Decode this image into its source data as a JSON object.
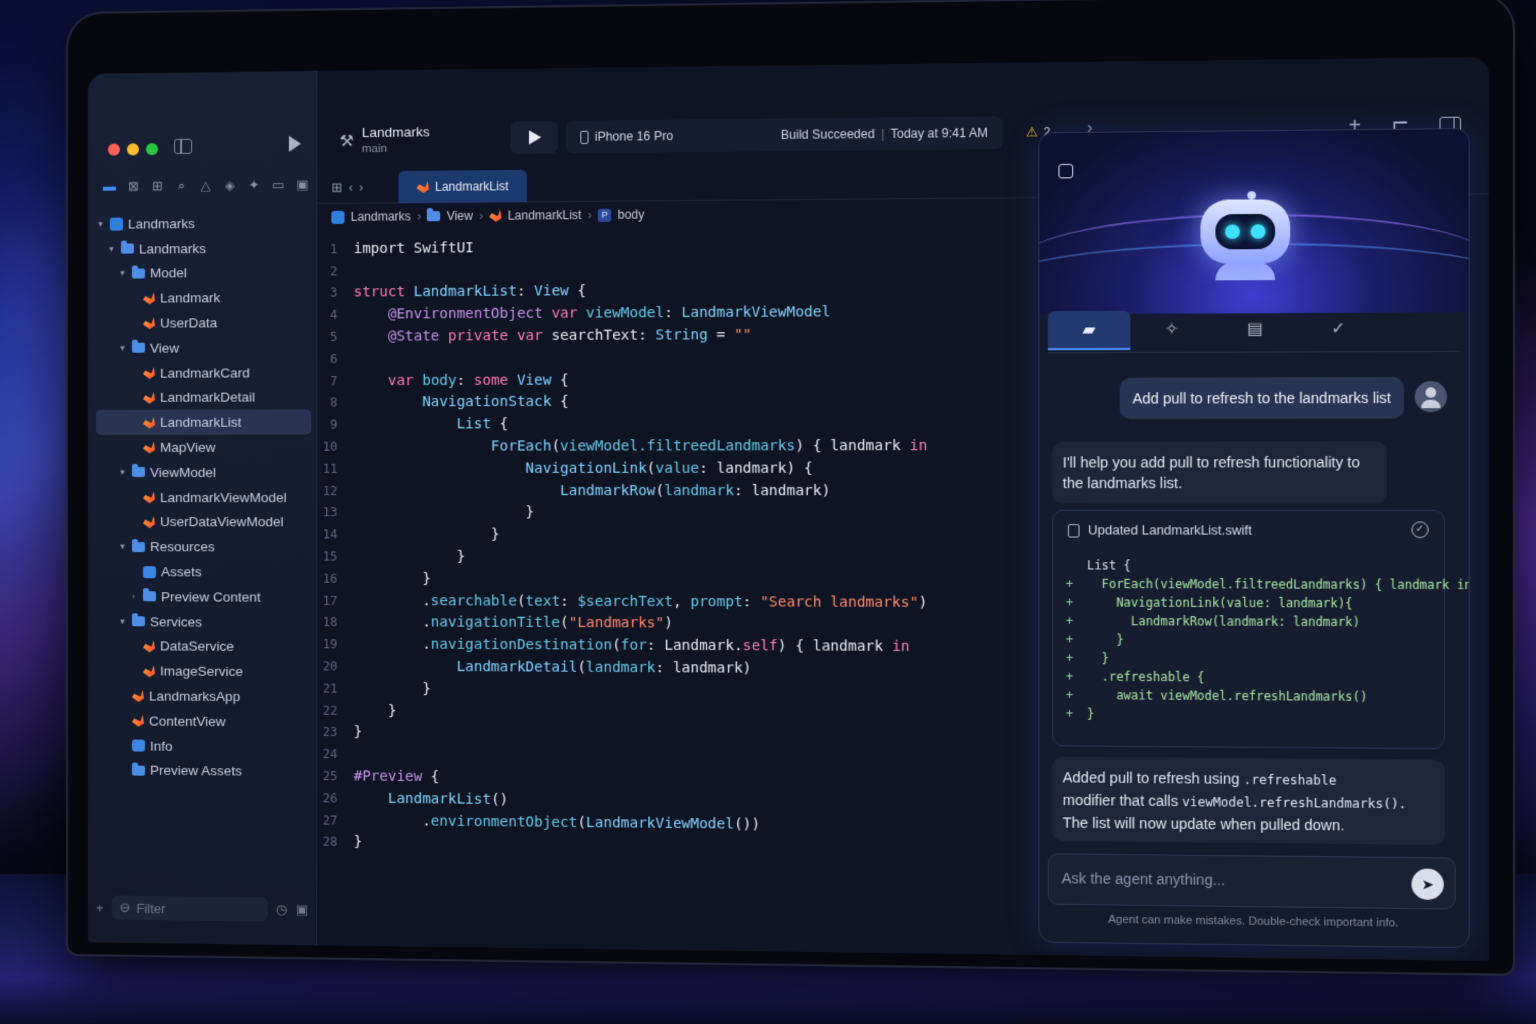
{
  "colors": {
    "accent": "#3a8cff",
    "keyword": "#ff7ab6",
    "type": "#7fd4ff",
    "string": "#ff8a6b",
    "diff_add": "#7fe28f",
    "warning": "#f5b82e"
  },
  "window": {
    "traffic": [
      "close",
      "minimize",
      "zoom"
    ]
  },
  "toolbar": {
    "project": "Landmarks",
    "branch": "main",
    "device": "iPhone 16 Pro",
    "build_status": "Build Succeeded",
    "separator": "|",
    "build_time": "Today at 9:41 AM",
    "warnings": "2"
  },
  "tab": {
    "label": "LandmarkList"
  },
  "breadcrumb": [
    "Landmarks",
    "View",
    "LandmarkList",
    "body"
  ],
  "navigator": {
    "items": [
      {
        "label": "Landmarks",
        "icon": "project",
        "depth": 0,
        "open": true
      },
      {
        "label": "Landmarks",
        "icon": "folder",
        "depth": 1,
        "open": true
      },
      {
        "label": "Model",
        "icon": "folder",
        "depth": 2,
        "open": true
      },
      {
        "label": "Landmark",
        "icon": "swift",
        "depth": 3
      },
      {
        "label": "UserData",
        "icon": "swift",
        "depth": 3
      },
      {
        "label": "View",
        "icon": "folder",
        "depth": 2,
        "open": true
      },
      {
        "label": "LandmarkCard",
        "icon": "swift",
        "depth": 3
      },
      {
        "label": "LandmarkDetail",
        "icon": "swift",
        "depth": 3
      },
      {
        "label": "LandmarkList",
        "icon": "swift",
        "depth": 3,
        "selected": true
      },
      {
        "label": "MapView",
        "icon": "swift",
        "depth": 3
      },
      {
        "label": "ViewModel",
        "icon": "folder",
        "depth": 2,
        "open": true
      },
      {
        "label": "LandmarkViewModel",
        "icon": "swift",
        "depth": 3
      },
      {
        "label": "UserDataViewModel",
        "icon": "swift",
        "depth": 3
      },
      {
        "label": "Resources",
        "icon": "folder",
        "depth": 2,
        "open": true
      },
      {
        "label": "Assets",
        "icon": "asset",
        "depth": 3
      },
      {
        "label": "Preview Content",
        "icon": "folder",
        "depth": 3,
        "open": false
      },
      {
        "label": "Services",
        "icon": "folder",
        "depth": 2,
        "open": true
      },
      {
        "label": "DataService",
        "icon": "swift",
        "depth": 3
      },
      {
        "label": "ImageService",
        "icon": "swift",
        "depth": 3
      },
      {
        "label": "LandmarksApp",
        "icon": "swift",
        "depth": 2
      },
      {
        "label": "ContentView",
        "icon": "swift",
        "depth": 2
      },
      {
        "label": "Info",
        "icon": "asset",
        "depth": 2
      },
      {
        "label": "Preview Assets",
        "icon": "folder",
        "depth": 2
      }
    ],
    "filter_placeholder": "Filter"
  },
  "code": [
    [
      [
        "pl",
        "import SwiftUI"
      ]
    ],
    [],
    [
      [
        "kw",
        "struct"
      ],
      [
        "pl",
        " "
      ],
      [
        "ty",
        "LandmarkList"
      ],
      [
        "pl",
        ": "
      ],
      [
        "ty",
        "View"
      ],
      [
        "pl",
        " {"
      ]
    ],
    [
      [
        "pl",
        "    "
      ],
      [
        "attr",
        "@EnvironmentObject"
      ],
      [
        "pl",
        " "
      ],
      [
        "kw",
        "var"
      ],
      [
        "pl",
        " "
      ],
      [
        "fn",
        "viewModel"
      ],
      [
        "pl",
        ": "
      ],
      [
        "ty",
        "LandmarkViewModel"
      ]
    ],
    [
      [
        "pl",
        "    "
      ],
      [
        "attr",
        "@State"
      ],
      [
        "pl",
        " "
      ],
      [
        "kw",
        "private"
      ],
      [
        "pl",
        " "
      ],
      [
        "kw",
        "var"
      ],
      [
        "pl",
        " searchText: "
      ],
      [
        "ty",
        "String"
      ],
      [
        "pl",
        " = "
      ],
      [
        "str",
        "\"\""
      ]
    ],
    [],
    [
      [
        "pl",
        "    "
      ],
      [
        "kw",
        "var"
      ],
      [
        "pl",
        " "
      ],
      [
        "fn",
        "body"
      ],
      [
        "pl",
        ": "
      ],
      [
        "kw",
        "some"
      ],
      [
        "pl",
        " "
      ],
      [
        "ty",
        "View"
      ],
      [
        "pl",
        " {"
      ]
    ],
    [
      [
        "pl",
        "        "
      ],
      [
        "ty",
        "NavigationStack"
      ],
      [
        "pl",
        " {"
      ]
    ],
    [
      [
        "pl",
        "            "
      ],
      [
        "ty",
        "List"
      ],
      [
        "pl",
        " {"
      ]
    ],
    [
      [
        "pl",
        "                "
      ],
      [
        "ty",
        "ForEach"
      ],
      [
        "pl",
        "("
      ],
      [
        "fn",
        "viewModel.filtreedLandmarks"
      ],
      [
        "pl",
        ") { landmark "
      ],
      [
        "kw",
        "in"
      ]
    ],
    [
      [
        "pl",
        "                    "
      ],
      [
        "ty",
        "NavigationLink"
      ],
      [
        "pl",
        "("
      ],
      [
        "fn",
        "value"
      ],
      [
        "pl",
        ": landmark) {"
      ]
    ],
    [
      [
        "pl",
        "                        "
      ],
      [
        "ty",
        "LandmarkRow"
      ],
      [
        "pl",
        "("
      ],
      [
        "fn",
        "landmark"
      ],
      [
        "pl",
        ": landmark)"
      ]
    ],
    [
      [
        "pl",
        "                    }"
      ]
    ],
    [
      [
        "pl",
        "                }"
      ]
    ],
    [
      [
        "pl",
        "            }"
      ]
    ],
    [
      [
        "pl",
        "        }"
      ]
    ],
    [
      [
        "pl",
        "        ."
      ],
      [
        "fn",
        "searchable"
      ],
      [
        "pl",
        "("
      ],
      [
        "fn",
        "text"
      ],
      [
        "pl",
        ": "
      ],
      [
        "fn",
        "$searchText"
      ],
      [
        "pl",
        ", "
      ],
      [
        "fn",
        "prompt"
      ],
      [
        "pl",
        ": "
      ],
      [
        "str",
        "\"Search landmarks\""
      ],
      [
        "pl",
        ")"
      ]
    ],
    [
      [
        "pl",
        "        ."
      ],
      [
        "fn",
        "navigationTitle"
      ],
      [
        "pl",
        "("
      ],
      [
        "str",
        "\"Landmarks\""
      ],
      [
        "pl",
        ")"
      ]
    ],
    [
      [
        "pl",
        "        ."
      ],
      [
        "fn",
        "navigationDestination"
      ],
      [
        "pl",
        "("
      ],
      [
        "fn",
        "for"
      ],
      [
        "pl",
        ": Landmark."
      ],
      [
        "kw",
        "self"
      ],
      [
        "pl",
        ") { landmark "
      ],
      [
        "kw",
        "in"
      ]
    ],
    [
      [
        "pl",
        "            "
      ],
      [
        "ty",
        "LandmarkDetail"
      ],
      [
        "pl",
        "("
      ],
      [
        "fn",
        "landmark"
      ],
      [
        "pl",
        ": landmark)"
      ]
    ],
    [
      [
        "pl",
        "        }"
      ]
    ],
    [
      [
        "pl",
        "    }"
      ]
    ],
    [
      [
        "pl",
        "}"
      ]
    ],
    [],
    [
      [
        "attr",
        "#Preview"
      ],
      [
        "pl",
        " {"
      ]
    ],
    [
      [
        "pl",
        "    "
      ],
      [
        "ty",
        "LandmarkList"
      ],
      [
        "pl",
        "()"
      ]
    ],
    [
      [
        "pl",
        "        ."
      ],
      [
        "fn",
        "environmentObject"
      ],
      [
        "pl",
        "("
      ],
      [
        "ty",
        "LandmarkViewModel"
      ],
      [
        "pl",
        "())"
      ]
    ],
    [
      [
        "pl",
        "}"
      ]
    ]
  ],
  "agent": {
    "tabs": [
      "chat-icon",
      "magic-wand-icon",
      "clipboard-icon",
      "checkmark-circle-icon"
    ],
    "user_message": "Add pull to refresh to the landmarks list",
    "agent_message": "I'll help you add pull to refresh functionality to the landmarks list.",
    "diff_title": "Updated LandmarkList.swift",
    "diff_lines": [
      {
        "plus": "",
        "code": "List {"
      },
      {
        "plus": "+",
        "code": "  ForEach(viewModel.filtreedLandmarks) { landmark in"
      },
      {
        "plus": "+",
        "code": "    NavigationLink(value: landmark){"
      },
      {
        "plus": "+",
        "code": "      LandmarkRow(landmark: landmark)"
      },
      {
        "plus": "+",
        "code": "    }"
      },
      {
        "plus": "+",
        "code": "  }"
      },
      {
        "plus": "+",
        "code": "  .refreshable {"
      },
      {
        "plus": "+",
        "code": "    await viewModel.refreshLandmarks()"
      },
      {
        "plus": "+",
        "code": "}"
      }
    ],
    "summary_1": "Added pull to refresh using ",
    "summary_code_1": ".refreshable",
    "summary_2": "modifier that calls ",
    "summary_code_2": "viewModel.refreshLandmarks().",
    "summary_3": "The list will now update when pulled down.",
    "input_placeholder": "Ask the agent anything...",
    "disclaimer": "Agent can make mistakes. Double-check important info."
  }
}
